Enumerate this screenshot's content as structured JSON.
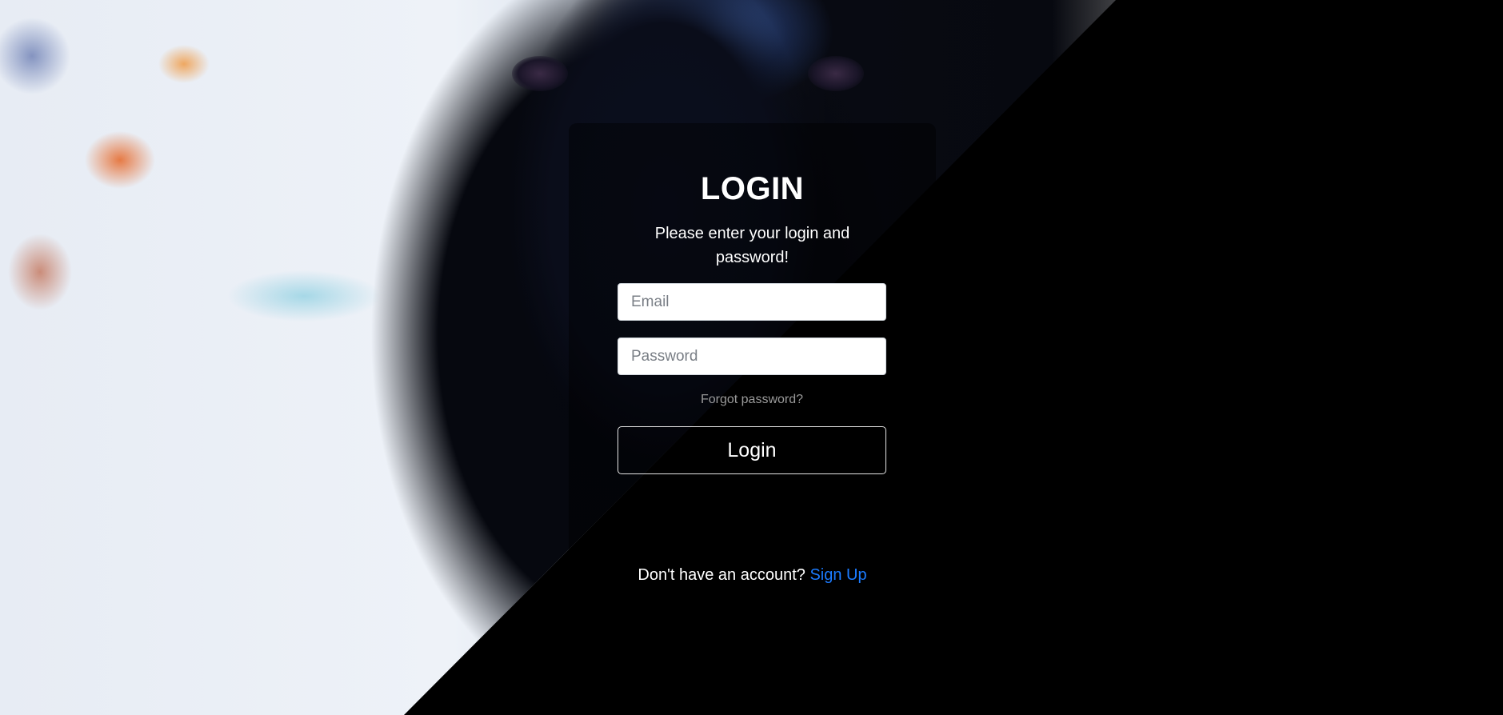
{
  "login": {
    "title": "LOGIN",
    "subtitle": "Please enter your login and password!",
    "email_placeholder": "Email",
    "password_placeholder": "Password",
    "forgot_password": "Forgot password?",
    "login_button": "Login",
    "signup_prompt": "Don't have an account?",
    "signup_link": "Sign Up"
  },
  "colors": {
    "background": "#000000",
    "link": "#1b7bff",
    "muted_text": "#9a9a9a",
    "text": "#ffffff"
  }
}
